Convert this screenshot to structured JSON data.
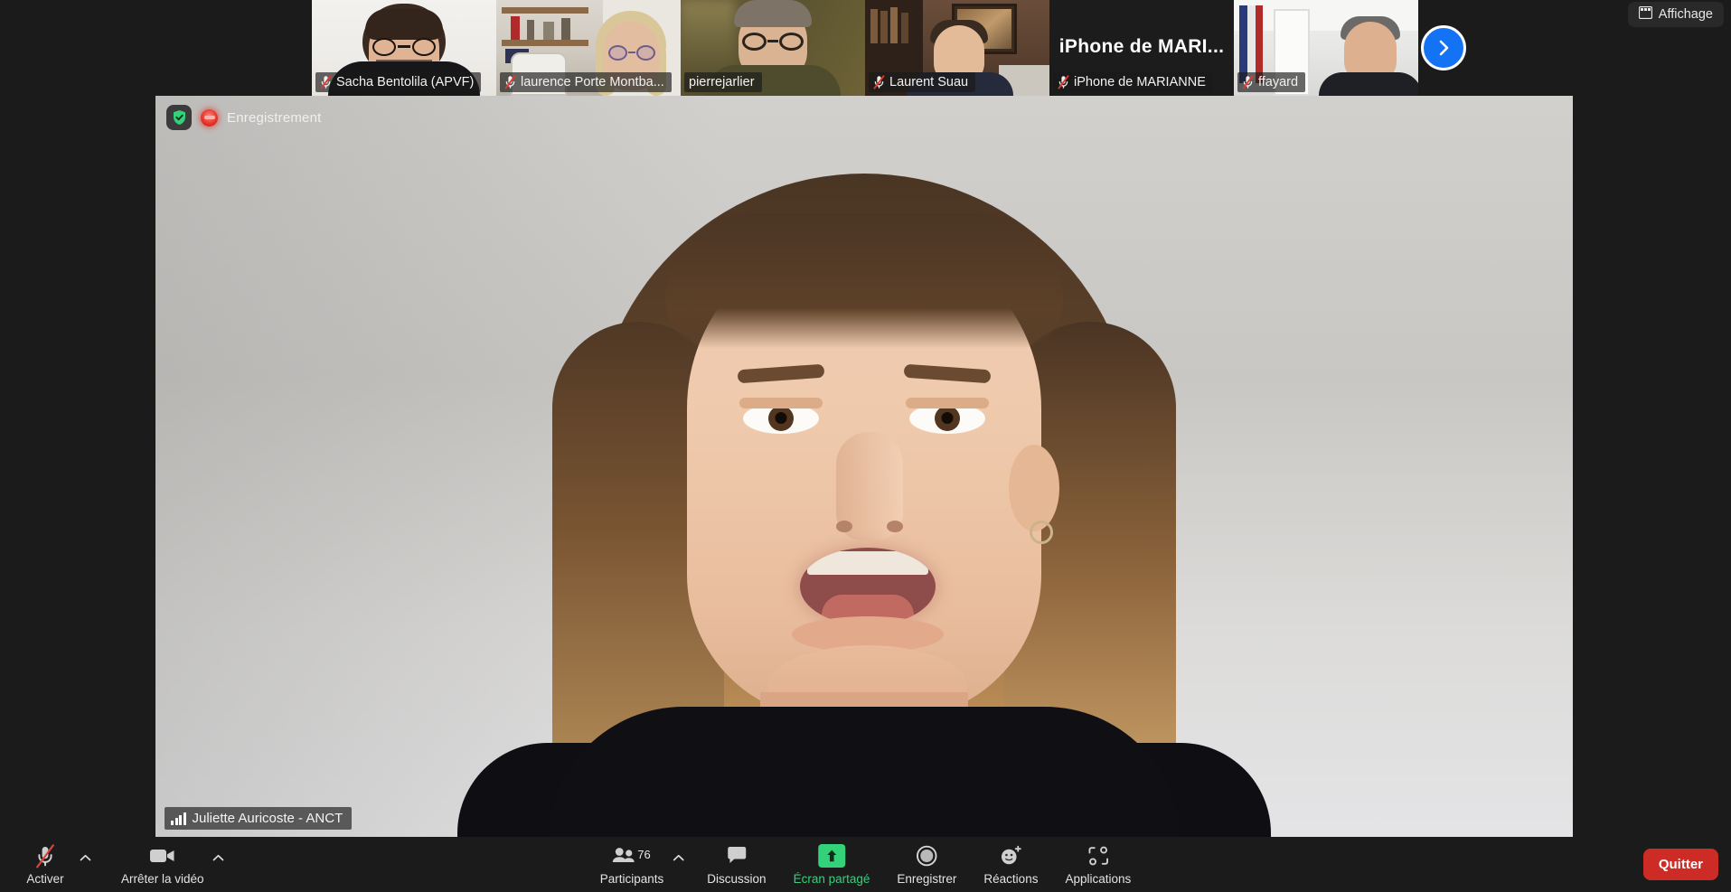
{
  "app": {
    "name": "Zoom Meeting",
    "language": "fr"
  },
  "colors": {
    "background": "#1b1b1b",
    "accent_blue": "#1472f5",
    "share_green": "#33d17a",
    "leave_red": "#cc2b26",
    "record_red": "#e8352a",
    "shield_green": "#33d17a"
  },
  "header": {
    "view_button": {
      "label": "Affichage",
      "icon": "grid-view-icon"
    },
    "next_page_button": {
      "icon": "chevron-right-icon",
      "label": ""
    }
  },
  "filmstrip": {
    "thumbnails": [
      {
        "name": "Sacha Bentolila (APVF)",
        "muted": true,
        "video_on": true,
        "big_name": ""
      },
      {
        "name": "laurence Porte Montba...",
        "muted": true,
        "video_on": true,
        "big_name": ""
      },
      {
        "name": "pierrejarlier",
        "muted": false,
        "video_on": true,
        "big_name": ""
      },
      {
        "name": "Laurent Suau",
        "muted": true,
        "video_on": true,
        "big_name": ""
      },
      {
        "name": "iPhone de MARIANNE",
        "muted": true,
        "video_on": false,
        "big_name": "iPhone de MARI..."
      },
      {
        "name": "ffayard",
        "muted": true,
        "video_on": true,
        "big_name": ""
      }
    ]
  },
  "stage": {
    "recording_status": {
      "label": "Enregistrement",
      "icon": "record-dot-icon"
    },
    "encryption_badge": {
      "icon": "shield-check-icon"
    },
    "active_speaker": {
      "name": "Juliette Auricoste - ANCT",
      "icon": "audio-level-icon"
    }
  },
  "toolbar": {
    "left": [
      {
        "label": "Activer",
        "icon": "microphone-muted-icon",
        "has_caret": true
      },
      {
        "label": "Arrêter la vidéo",
        "icon": "video-camera-icon",
        "has_caret": true
      }
    ],
    "center": [
      {
        "label": "Participants",
        "icon": "participants-icon",
        "count": "76",
        "has_caret": true,
        "highlight": false
      },
      {
        "label": "Discussion",
        "icon": "chat-bubble-icon",
        "count": "",
        "has_caret": false,
        "highlight": false
      },
      {
        "label": "Écran partagé",
        "icon": "share-screen-icon",
        "count": "",
        "has_caret": false,
        "highlight": true
      },
      {
        "label": "Enregistrer",
        "icon": "record-circle-icon",
        "count": "",
        "has_caret": false,
        "highlight": false
      },
      {
        "label": "Réactions",
        "icon": "reactions-smiley-icon",
        "count": "",
        "has_caret": false,
        "highlight": false
      },
      {
        "label": "Applications",
        "icon": "applications-icon",
        "count": "",
        "has_caret": false,
        "highlight": false
      }
    ],
    "right": {
      "leave_label": "Quitter"
    }
  }
}
